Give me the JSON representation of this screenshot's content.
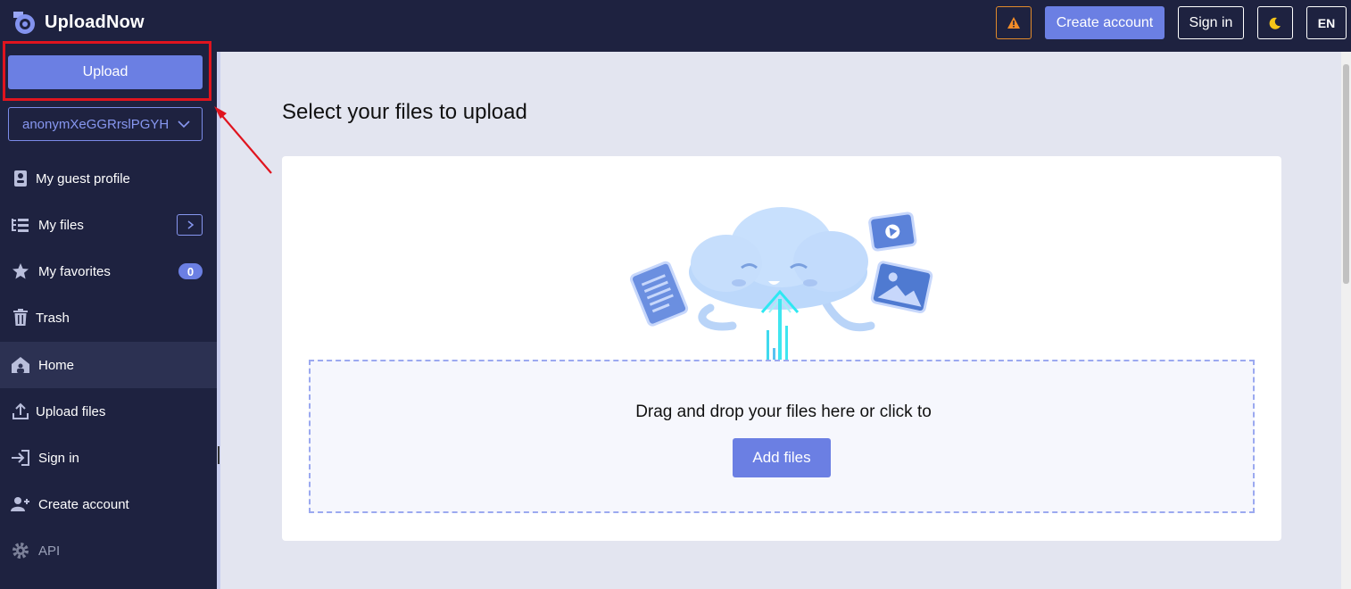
{
  "header": {
    "app_name": "UploadNow",
    "create_account_label": "Create account",
    "sign_in_label": "Sign in",
    "language_label": "EN",
    "icons": [
      "logo-icon",
      "warning-icon",
      "moon-icon"
    ]
  },
  "sidebar": {
    "upload_label": "Upload",
    "user_select_value": "anonymXeGGRrslPGYH",
    "items": [
      {
        "label": "My guest profile",
        "icon": "profile-icon"
      },
      {
        "label": "My files",
        "icon": "tree-icon"
      },
      {
        "label": "My favorites",
        "icon": "star-icon",
        "badge": "0"
      },
      {
        "label": "Trash",
        "icon": "trash-icon"
      },
      {
        "label": "Home",
        "icon": "home-icon",
        "active": true
      },
      {
        "label": "Upload files",
        "icon": "upload-icon"
      },
      {
        "label": "Sign in",
        "icon": "sign-in-icon"
      },
      {
        "label": "Create account",
        "icon": "add-user-icon"
      },
      {
        "label": "API",
        "icon": "gear-icon"
      }
    ]
  },
  "main": {
    "title": "Select your files to upload",
    "drop_text": "Drag and drop your files here or click to",
    "add_files_label": "Add files"
  },
  "colors": {
    "nav_bg": "#1e2240",
    "accent": "#6b7fe3",
    "page_bg": "#e3e5f0",
    "highlight": "#e0141e"
  }
}
